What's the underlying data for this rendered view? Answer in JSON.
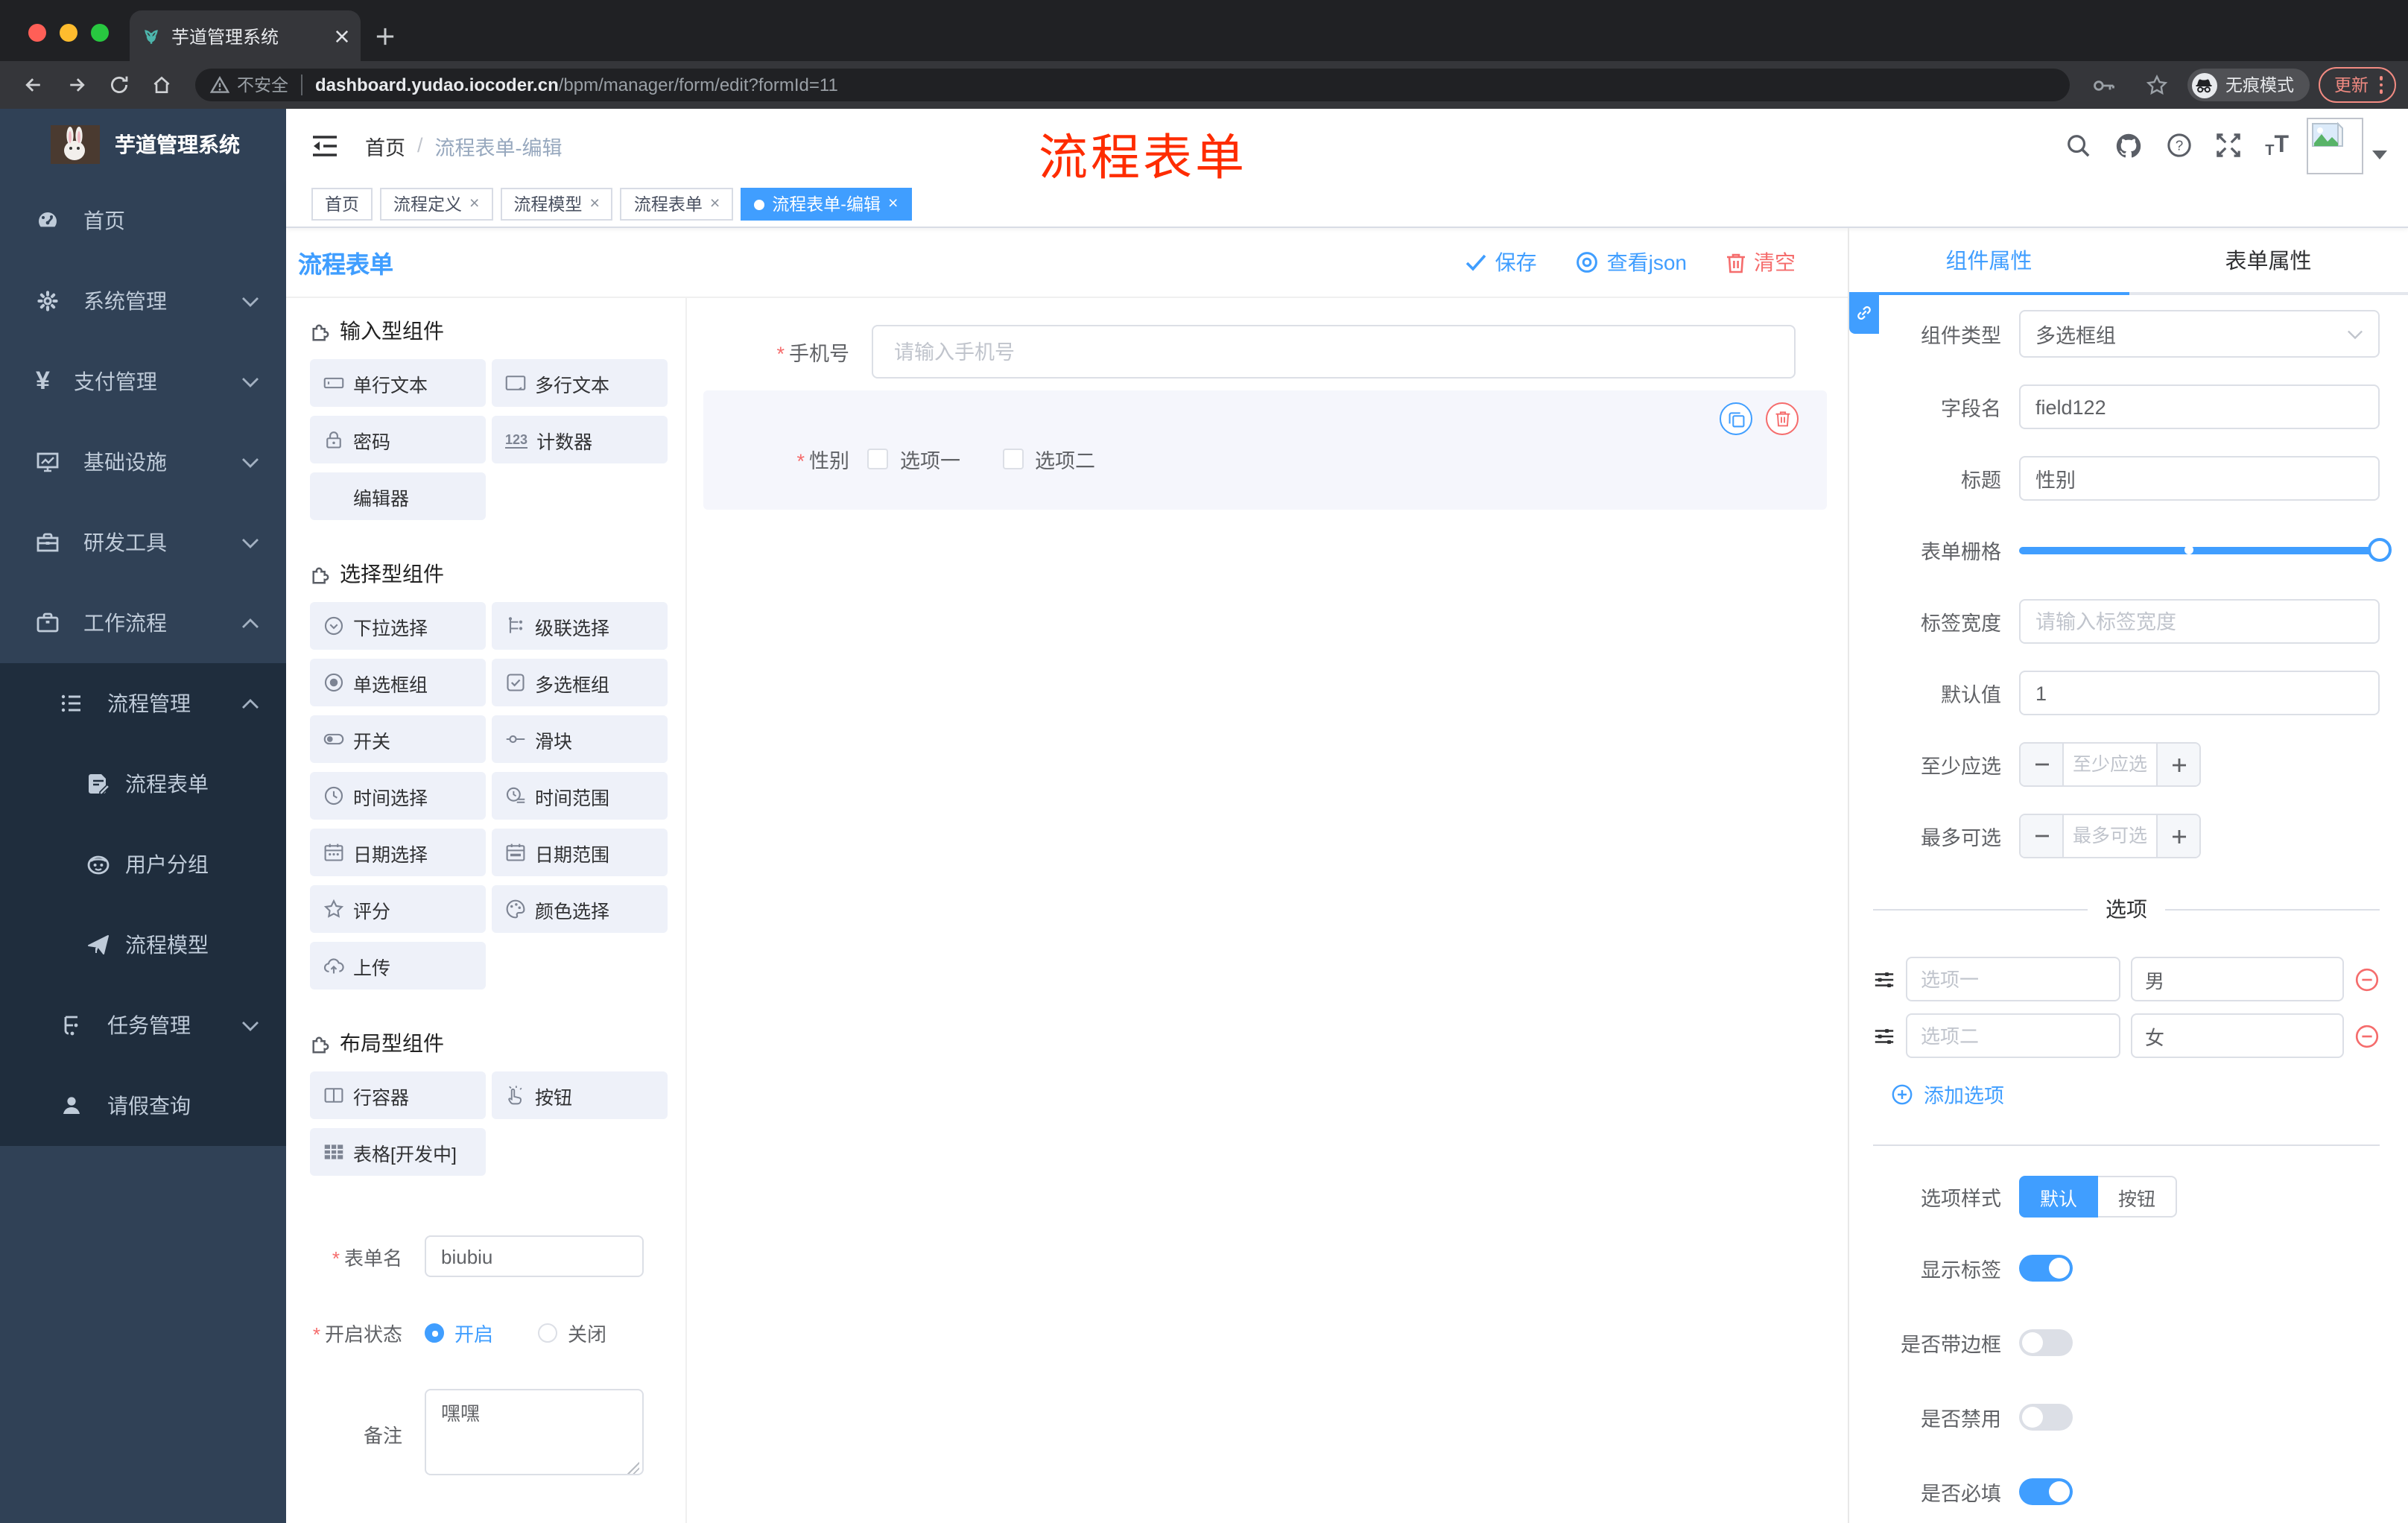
{
  "browser": {
    "tab_title": "芋道管理系统",
    "security_label": "不安全",
    "url_host": "dashboard.yudao.iocoder.cn",
    "url_path": "/bpm/manager/form/edit?formId=11",
    "incognito_label": "无痕模式",
    "update_label": "更新"
  },
  "sidebar": {
    "title": "芋道管理系统",
    "items": [
      {
        "label": "首页"
      },
      {
        "label": "系统管理"
      },
      {
        "label": "支付管理"
      },
      {
        "label": "基础设施"
      },
      {
        "label": "研发工具"
      },
      {
        "label": "工作流程"
      }
    ],
    "submenu": [
      {
        "label": "流程管理"
      },
      {
        "label": "流程表单"
      },
      {
        "label": "用户分组"
      },
      {
        "label": "流程模型"
      },
      {
        "label": "任务管理"
      },
      {
        "label": "请假查询"
      }
    ]
  },
  "header": {
    "breadcrumb_home": "首页",
    "breadcrumb_sep": "/",
    "breadcrumb_current": "流程表单-编辑",
    "watermark": "流程表单"
  },
  "tags": [
    {
      "label": "首页"
    },
    {
      "label": "流程定义"
    },
    {
      "label": "流程模型"
    },
    {
      "label": "流程表单"
    },
    {
      "label": "流程表单-编辑"
    }
  ],
  "designer": {
    "title": "流程表单",
    "save_label": "保存",
    "view_json_label": "查看json",
    "clear_label": "清空"
  },
  "components": {
    "sections": [
      {
        "title": "输入型组件",
        "items": [
          "单行文本",
          "多行文本",
          "密码",
          "计数器",
          "编辑器"
        ]
      },
      {
        "title": "选择型组件",
        "items": [
          "下拉选择",
          "级联选择",
          "单选框组",
          "多选框组",
          "开关",
          "滑块",
          "时间选择",
          "时间范围",
          "日期选择",
          "日期范围",
          "评分",
          "颜色选择",
          "上传"
        ]
      },
      {
        "title": "布局型组件",
        "items": [
          "行容器",
          "按钮",
          "表格[开发中]"
        ]
      }
    ]
  },
  "form_meta": {
    "name_label": "表单名",
    "name_value": "biubiu",
    "status_label": "开启状态",
    "status_on": "开启",
    "status_off": "关闭",
    "remark_label": "备注",
    "remark_value": "嘿嘿"
  },
  "canvas": {
    "phone_label": "手机号",
    "phone_placeholder": "请输入手机号",
    "gender_label": "性别",
    "gender_option1": "选项一",
    "gender_option2": "选项二"
  },
  "props": {
    "tab_component": "组件属性",
    "tab_form": "表单属性",
    "rows": {
      "type_label": "组件类型",
      "type_value": "多选框组",
      "field_label": "字段名",
      "field_value": "field122",
      "title_label": "标题",
      "title_value": "性别",
      "grid_label": "表单栅格",
      "labelwidth_label": "标签宽度",
      "labelwidth_placeholder": "请输入标签宽度",
      "default_label": "默认值",
      "default_value": "1",
      "min_label": "至少应选",
      "min_placeholder": "至少应选",
      "max_label": "最多可选",
      "max_placeholder": "最多可选"
    },
    "options_title": "选项",
    "options": [
      {
        "label": "选项一",
        "value": "男"
      },
      {
        "label": "选项二",
        "value": "女"
      }
    ],
    "add_option_label": "添加选项",
    "style_label": "选项样式",
    "style_default": "默认",
    "style_button": "按钮",
    "switches": [
      {
        "label": "显示标签",
        "on": true
      },
      {
        "label": "是否带边框",
        "on": false
      },
      {
        "label": "是否禁用",
        "on": false
      },
      {
        "label": "是否必填",
        "on": true
      }
    ]
  },
  "icons": {
    "counter": "123",
    "payment": "¥",
    "font_size_small": "T",
    "font_size_big": "T",
    "help_mark": "?"
  },
  "colors": {
    "primary": "#409eff",
    "danger": "#f56c6c",
    "watermark": "#fe2c00",
    "sidebar": "#304156",
    "submenu": "#1f2d3d"
  }
}
